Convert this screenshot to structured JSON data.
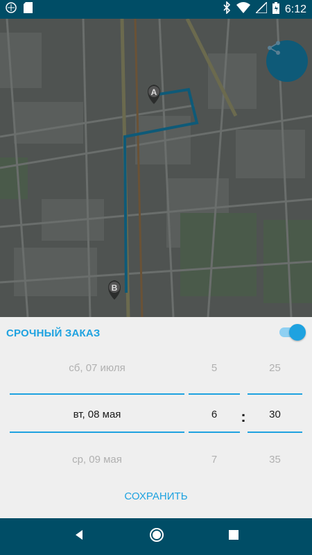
{
  "status_bar": {
    "time": "6:12",
    "icons": [
      "app-icon",
      "sd-card-icon",
      "bluetooth-icon",
      "wifi-icon",
      "signal-icon",
      "battery-icon"
    ]
  },
  "map": {
    "markers": [
      {
        "label": "A"
      },
      {
        "label": "B"
      }
    ],
    "share_icon": "share-icon"
  },
  "urgent": {
    "label": "СРОЧНЫЙ ЗАКАЗ",
    "enabled": true
  },
  "picker": {
    "dates": [
      "сб, 07 июля",
      "вт, 08 мая",
      "ср, 09 мая"
    ],
    "hours": [
      "5",
      "6",
      "7"
    ],
    "minutes": [
      "25",
      "30",
      "35"
    ],
    "separator": ":"
  },
  "save_label": "СОХРАНИТЬ",
  "nav": {
    "icons": [
      "back-icon",
      "home-icon",
      "recents-icon"
    ]
  },
  "colors": {
    "accent": "#1ea2e0",
    "statusbar": "#004d66",
    "sheet": "#efefef"
  }
}
